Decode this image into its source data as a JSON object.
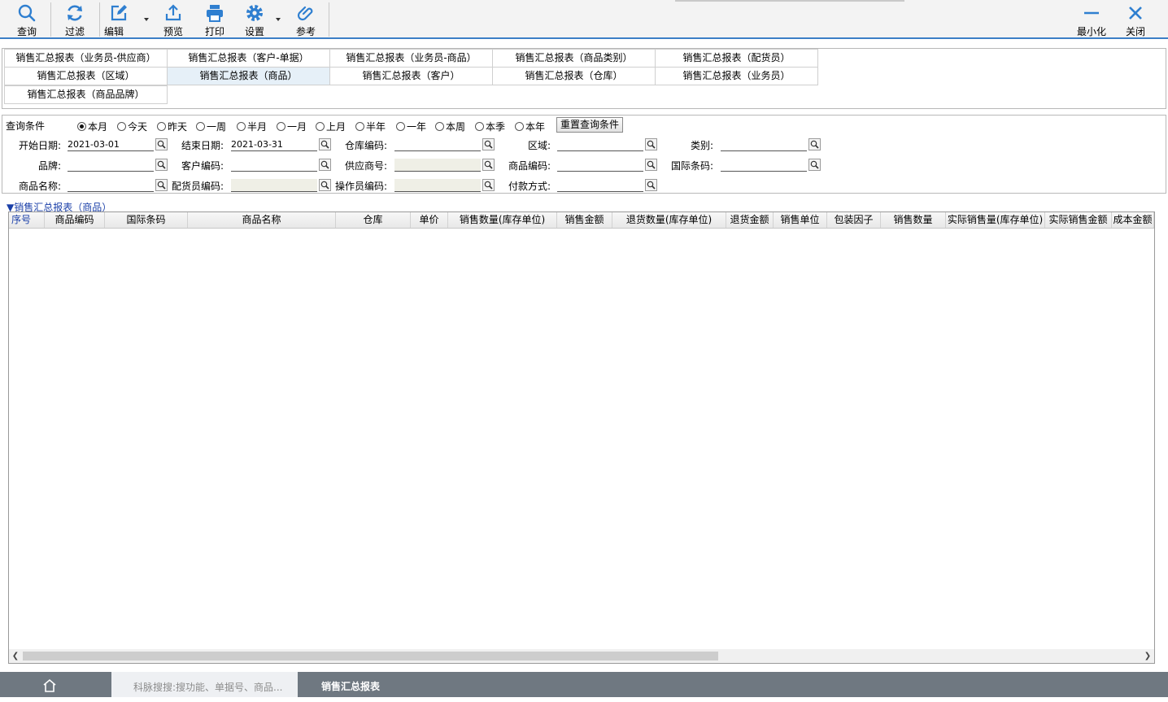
{
  "toolbar": {
    "query": "查询",
    "filter": "过滤",
    "edit": "编辑",
    "preview": "预览",
    "print": "打印",
    "settings": "设置",
    "reference": "参考",
    "minimize": "最小化",
    "close": "关闭"
  },
  "report_tabs": [
    "销售汇总报表（业务员-供应商）",
    "销售汇总报表（客户-单据）",
    "销售汇总报表（业务员-商品）",
    "销售汇总报表（商品类别）",
    "销售汇总报表（配货员）",
    "销售汇总报表（区域）",
    "销售汇总报表（商品）",
    "销售汇总报表（客户）",
    "销售汇总报表（仓库）",
    "销售汇总报表（业务员）",
    "销售汇总报表（商品品牌）"
  ],
  "active_report_tab": "销售汇总报表（商品）",
  "query": {
    "label": "查询条件",
    "periods": [
      "本月",
      "今天",
      "昨天",
      "一周",
      "半月",
      "一月",
      "上月",
      "半年",
      "一年",
      "本周",
      "本季",
      "本年"
    ],
    "selected_period": "本月",
    "reset_label": "重置查询条件",
    "fields": {
      "start_date": {
        "label": "开始日期:",
        "value": "2021-03-01"
      },
      "end_date": {
        "label": "结束日期:",
        "value": "2021-03-31"
      },
      "warehouse_code": {
        "label": "仓库编码:",
        "value": ""
      },
      "region": {
        "label": "区域:",
        "value": ""
      },
      "category": {
        "label": "类别:",
        "value": ""
      },
      "brand": {
        "label": "品牌:",
        "value": ""
      },
      "customer_code": {
        "label": "客户编码:",
        "value": ""
      },
      "supplier_no": {
        "label": "供应商号:",
        "value": ""
      },
      "product_code": {
        "label": "商品编码:",
        "value": ""
      },
      "barcode": {
        "label": "国际条码:",
        "value": ""
      },
      "product_name": {
        "label": "商品名称:",
        "value": ""
      },
      "picker_code": {
        "label": "配货员编码:",
        "value": ""
      },
      "operator_code": {
        "label": "操作员编码:",
        "value": ""
      },
      "payment_method": {
        "label": "付款方式:",
        "value": ""
      }
    }
  },
  "grid": {
    "title": "▼销售汇总报表（商品）",
    "columns": [
      "序号",
      "商品编码",
      "国际条码",
      "商品名称",
      "仓库",
      "单价",
      "销售数量(库存单位)",
      "销售金额",
      "退货数量(库存单位)",
      "退货金额",
      "销售单位",
      "包装因子",
      "销售数量",
      "实际销售量(库存单位)",
      "实际销售金额",
      "成本金额"
    ]
  },
  "taskbar": {
    "search_placeholder": "科脉搜搜:搜功能、单据号、商品...",
    "active_tab": "销售汇总报表"
  },
  "colors": {
    "accent": "#3c7ec6",
    "icon_blue": "#2f7fd0",
    "taskbar": "#6f7881",
    "active_tab_bg": "#e6f0f8",
    "link_blue": "#1a3fa8"
  }
}
